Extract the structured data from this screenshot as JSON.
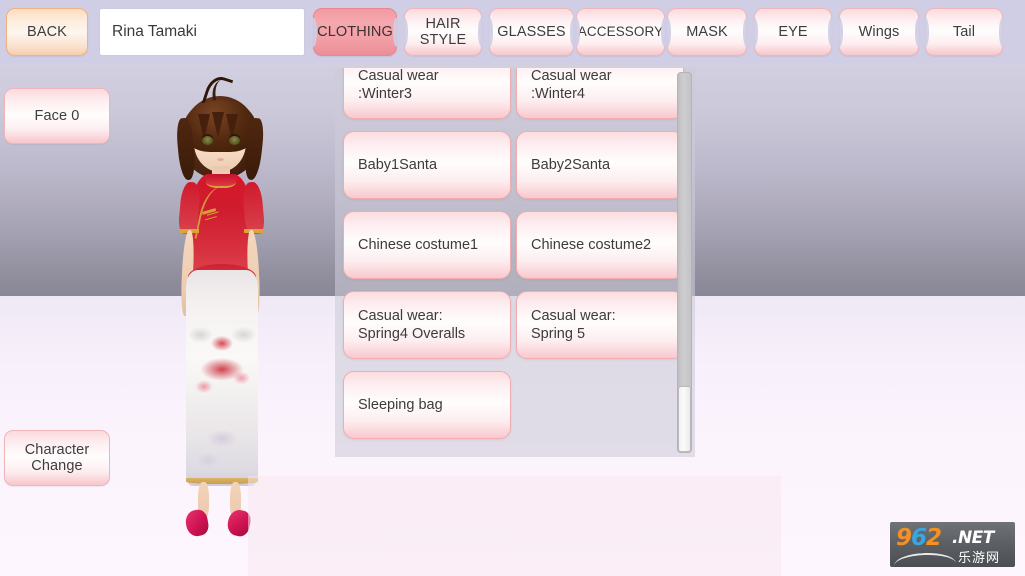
{
  "header": {
    "back_label": "BACK",
    "character_name": "Rina Tamaki",
    "name_placeholder": "Rina Tamaki"
  },
  "tabs": [
    {
      "label": "CLOTHING",
      "selected": true
    },
    {
      "label": "HAIR\nSTYLE",
      "selected": false
    },
    {
      "label": "GLASSES",
      "selected": false
    },
    {
      "label": "ACCESSORY",
      "selected": false
    },
    {
      "label": "MASK",
      "selected": false
    },
    {
      "label": "EYE",
      "selected": false
    },
    {
      "label": "Wings",
      "selected": false
    },
    {
      "label": "Tail",
      "selected": false
    }
  ],
  "side_buttons": [
    {
      "label": "Face 0",
      "name": "face-button"
    },
    {
      "label": "Character\nChange",
      "name": "character-change-button"
    }
  ],
  "item_list": {
    "items": [
      "Casual wear\n:Winter3",
      "Casual wear\n:Winter4",
      "Baby1Santa",
      "Baby2Santa",
      "Chinese costume1",
      "Chinese costume2",
      "Casual wear:\nSpring4 Overalls",
      "Casual wear:\nSpring 5",
      "Sleeping bag"
    ],
    "scroll_position": "bottom"
  },
  "watermark": {
    "digit1": "9",
    "digit2": "6",
    "digit3": "2",
    "net": ".NET",
    "cn": "乐游网"
  },
  "colors": {
    "accent_pink": "#f19aa2",
    "item_border": "#efacb1",
    "topbar": "#cfcde4",
    "back_button": "#fbdcc0",
    "sky_top": "#d5d3e3",
    "sky_horizon": "#8a8897",
    "floor": "#fef6fe",
    "watermark_orange": "#f79023",
    "watermark_blue": "#3aa6e0"
  }
}
